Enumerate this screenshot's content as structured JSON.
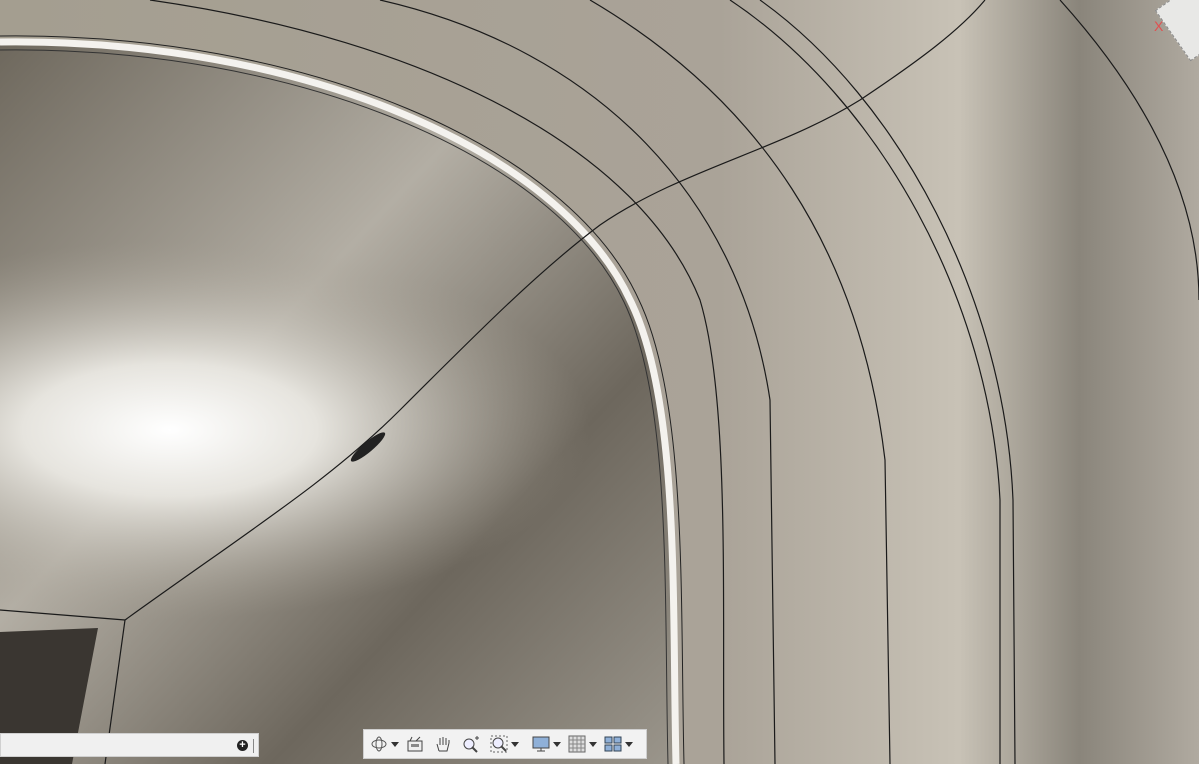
{
  "viewcube": {
    "axis_x_label": "X"
  },
  "command_bar": {
    "input_value": "",
    "add_icon": "plus-circle-icon"
  },
  "nav_toolbar": {
    "tools": [
      {
        "name": "orbit",
        "icon": "orbit-icon",
        "has_dropdown": true
      },
      {
        "name": "look-at",
        "icon": "look-at-icon",
        "has_dropdown": false
      },
      {
        "name": "pan",
        "icon": "hand-icon",
        "has_dropdown": false
      },
      {
        "name": "zoom",
        "icon": "zoom-icon",
        "has_dropdown": false
      },
      {
        "name": "fit",
        "icon": "zoom-window-icon",
        "has_dropdown": true
      },
      {
        "name": "display-settings",
        "icon": "monitor-icon",
        "has_dropdown": true
      },
      {
        "name": "grid-snaps",
        "icon": "grid-icon",
        "has_dropdown": true
      },
      {
        "name": "viewports",
        "icon": "viewports-icon",
        "has_dropdown": true
      }
    ]
  },
  "colors": {
    "surface": "#a39d91",
    "highlight": "#ffffff",
    "edge": "#1a1a1a",
    "axis_x": "#e05050"
  }
}
